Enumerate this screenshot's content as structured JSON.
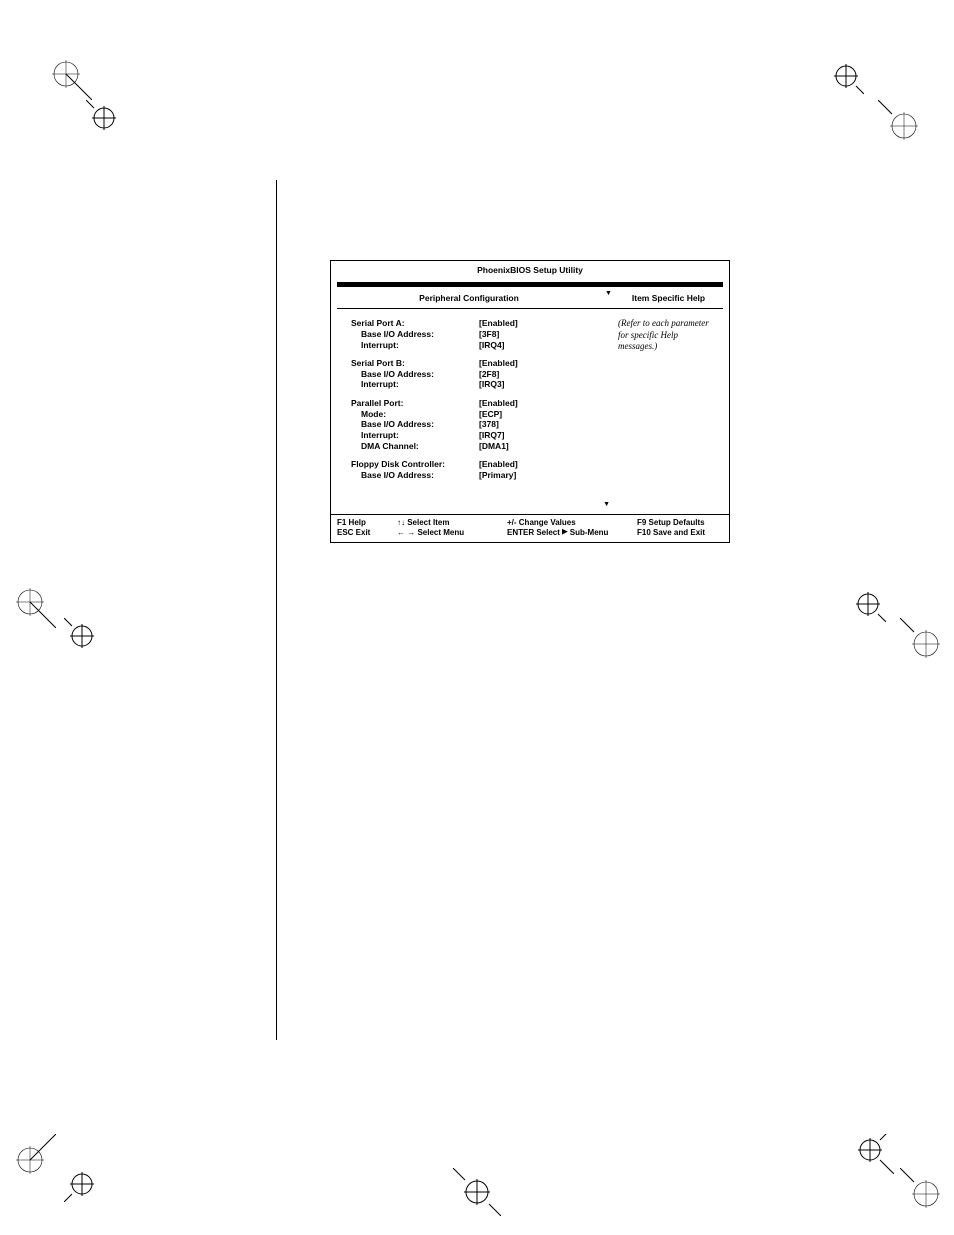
{
  "bios": {
    "title": "PhoenixBIOS Setup Utility",
    "section_header": "Peripheral Configuration",
    "help_header": "Item Specific Help",
    "help_text": "(Refer to each parameter for specific Help messages.)",
    "groups": [
      {
        "rows": [
          {
            "label": "Serial Port A:",
            "value": "[Enabled]",
            "sub": false
          },
          {
            "label": "Base I/O Address:",
            "value": "[3F8]",
            "sub": true
          },
          {
            "label": "Interrupt:",
            "value": "[IRQ4]",
            "sub": true
          }
        ]
      },
      {
        "rows": [
          {
            "label": "Serial Port B:",
            "value": "[Enabled]",
            "sub": false
          },
          {
            "label": "Base I/O Address:",
            "value": "[2F8]",
            "sub": true
          },
          {
            "label": "Interrupt:",
            "value": "[IRQ3]",
            "sub": true
          }
        ]
      },
      {
        "rows": [
          {
            "label": "Parallel Port:",
            "value": "[Enabled]",
            "sub": false
          },
          {
            "label": "Mode:",
            "value": "[ECP]",
            "sub": true
          },
          {
            "label": "Base I/O Address:",
            "value": "[378]",
            "sub": true
          },
          {
            "label": "Interrupt:",
            "value": "[IRQ7]",
            "sub": true
          },
          {
            "label": "DMA Channel:",
            "value": "[DMA1]",
            "sub": true
          }
        ]
      },
      {
        "rows": [
          {
            "label": "Floppy Disk Controller:",
            "value": "[Enabled]",
            "sub": false
          },
          {
            "label": "Base I/O Address:",
            "value": "[Primary]",
            "sub": true
          }
        ]
      }
    ],
    "footer": {
      "r1c1": "F1 Help",
      "r1c2": "↑↓   Select Item",
      "r1c3": "+/- Change Values",
      "r1c4": "F9 Setup Defaults",
      "r2c1": "ESC Exit",
      "r2c2": "← → Select Menu",
      "r2c3_a": "ENTER Select ",
      "r2c3_b": " Sub-Menu",
      "r2c4": "F10 Save and Exit"
    }
  }
}
